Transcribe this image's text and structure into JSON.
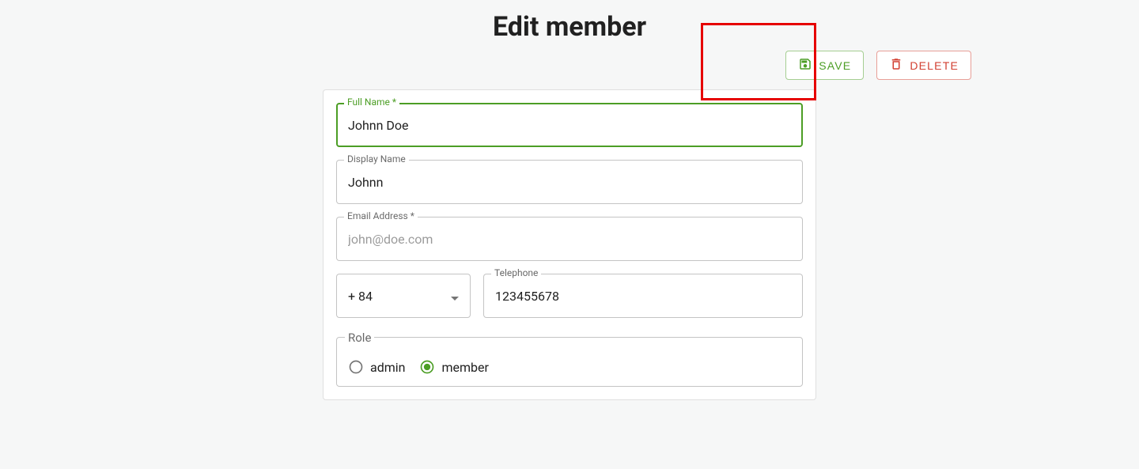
{
  "header": {
    "title": "Edit member"
  },
  "buttons": {
    "save_label": "Save",
    "delete_label": "Delete"
  },
  "form": {
    "full_name": {
      "label": "Full Name *",
      "value": "Johnn Doe"
    },
    "display_name": {
      "label": "Display Name",
      "value": "Johnn"
    },
    "email": {
      "label": "Email Address *",
      "placeholder": "john@doe.com",
      "value": ""
    },
    "country_code": {
      "value": "+ 84"
    },
    "telephone": {
      "label": "Telephone",
      "value": "123455678"
    },
    "role": {
      "legend": "Role",
      "options": {
        "admin": "admin",
        "member": "member"
      },
      "selected": "member"
    }
  },
  "colors": {
    "accent": "#4c9e25",
    "danger": "#d23f31"
  }
}
